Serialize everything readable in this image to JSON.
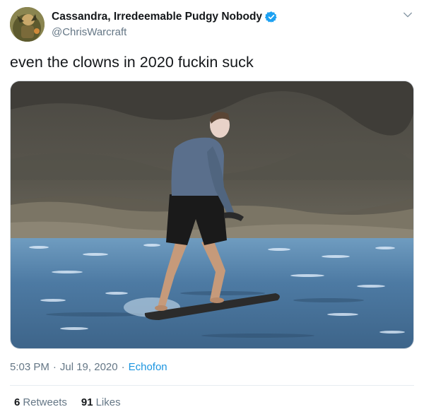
{
  "user": {
    "display_name": "Cassandra, Irredeemable Pudgy Nobody",
    "handle": "@ChrisWarcraft",
    "verified": true
  },
  "icons": {
    "verified": "verified-badge-icon",
    "caret": "chevron-down-icon"
  },
  "tweet": {
    "text": "even the clowns in 2020 fuckin suck"
  },
  "meta": {
    "time": "5:03 PM",
    "separator": "·",
    "date": "Jul 19, 2020",
    "separator2": "·",
    "source": "Echofon"
  },
  "stats": {
    "retweets_count": "6",
    "retweets_label": "Retweets",
    "likes_count": "91",
    "likes_label": "Likes"
  },
  "colors": {
    "accent": "#1da1f2",
    "secondary_text": "#657786",
    "primary_text": "#14171a"
  }
}
